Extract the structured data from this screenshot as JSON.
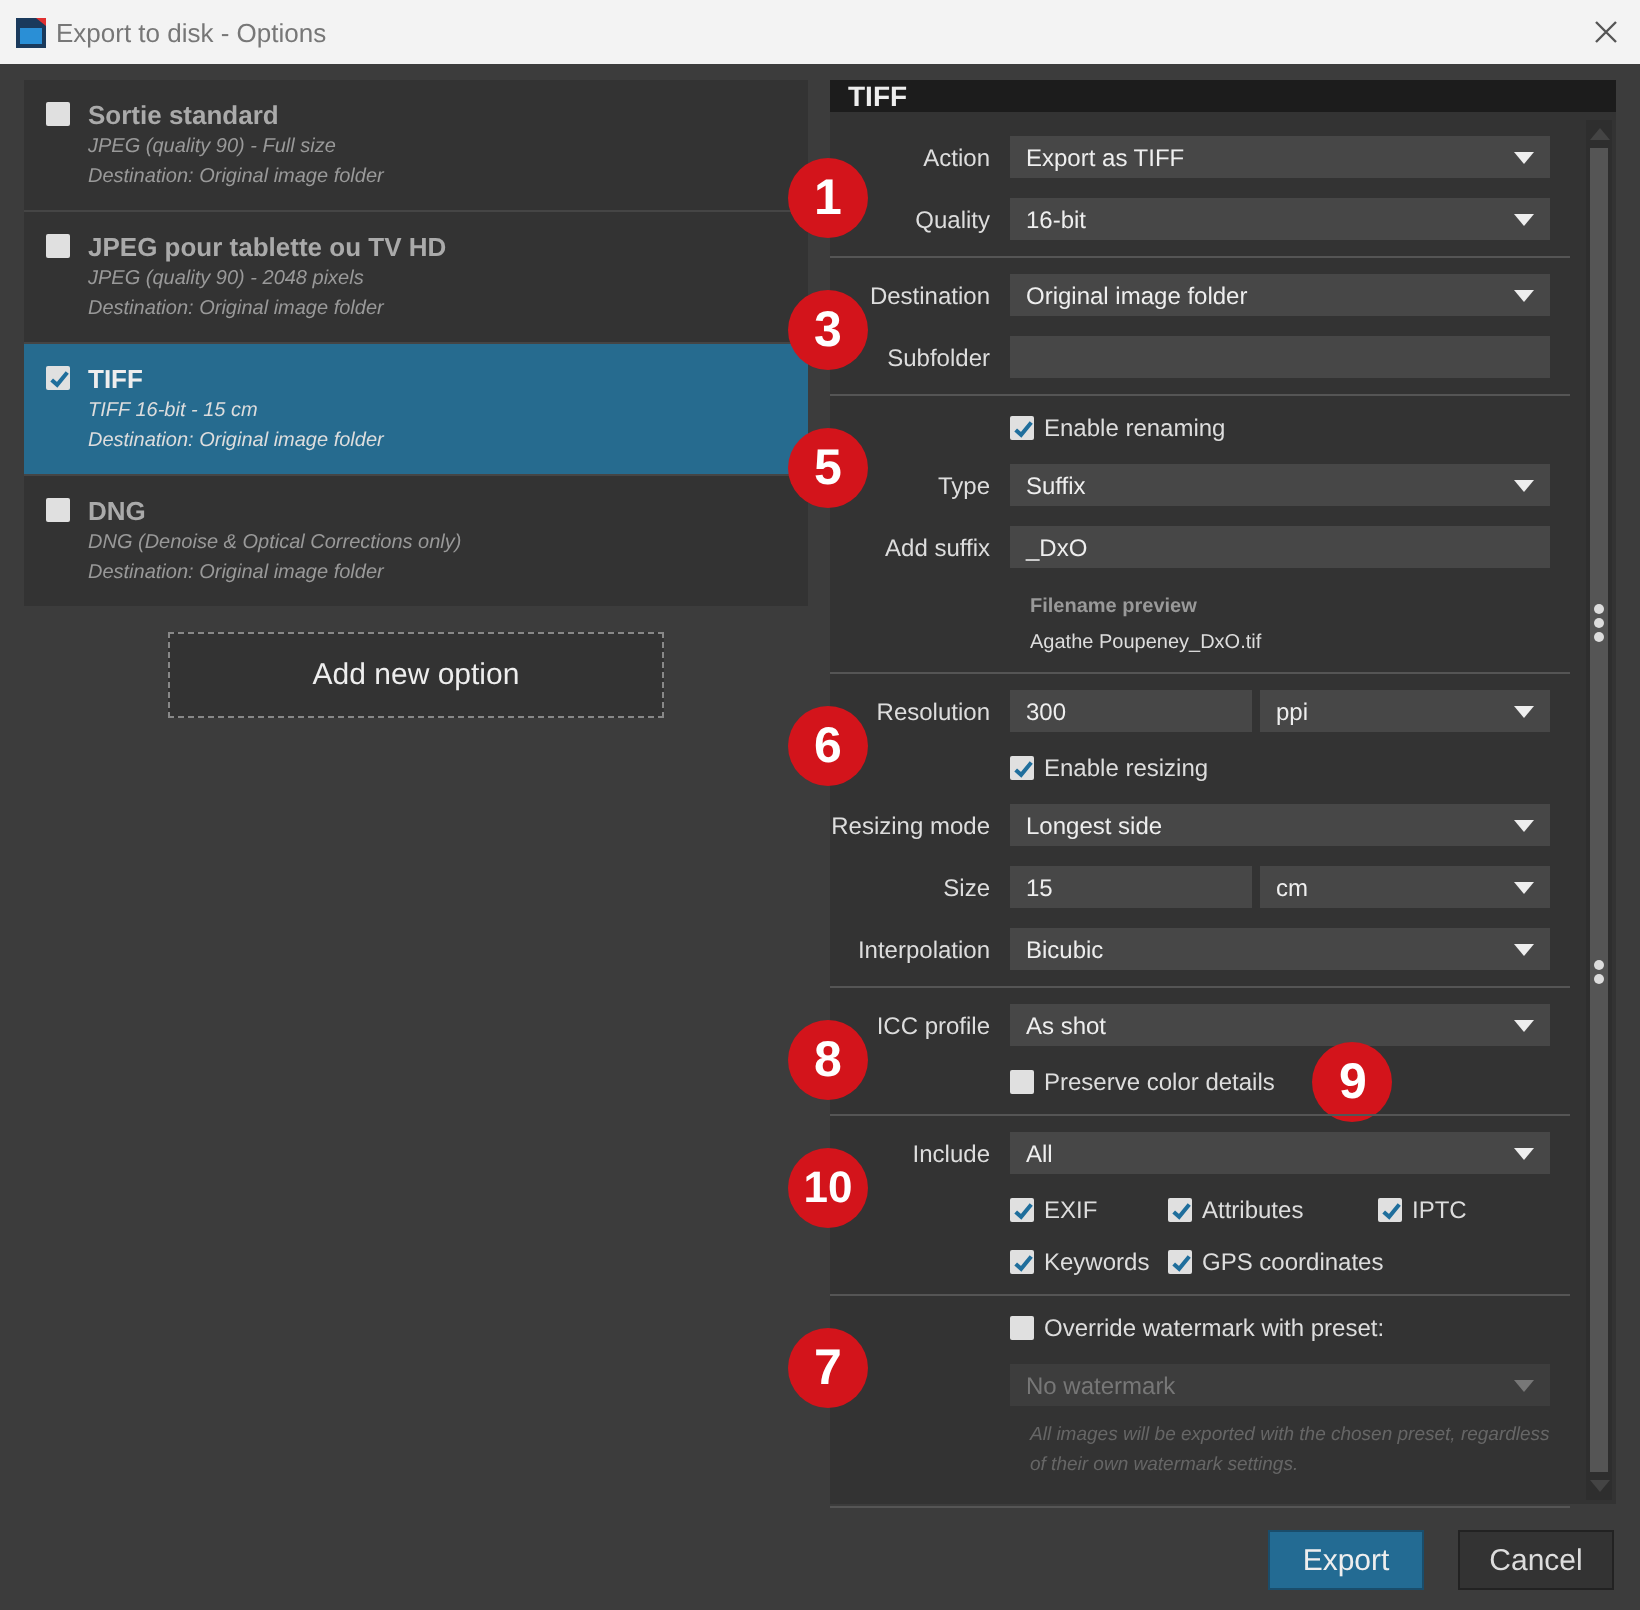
{
  "window": {
    "title": "Export to disk - Options"
  },
  "options": [
    {
      "name": "Sortie standard",
      "line1": "JPEG (quality 90) - Full size",
      "line2": "Destination: Original image folder",
      "checked": false,
      "selected": false
    },
    {
      "name": "JPEG pour tablette ou TV HD",
      "line1": "JPEG (quality 90) - 2048 pixels",
      "line2": "Destination: Original image folder",
      "checked": false,
      "selected": false
    },
    {
      "name": "TIFF",
      "line1": "TIFF 16-bit - 15 cm",
      "line2": "Destination: Original image folder",
      "checked": true,
      "selected": true
    },
    {
      "name": "DNG",
      "line1": "DNG (Denoise & Optical Corrections only)",
      "line2": "Destination: Original image folder",
      "checked": false,
      "selected": false
    }
  ],
  "add_button": "Add new option",
  "panel": {
    "title": "TIFF",
    "sections": [
      {
        "marker": "1",
        "rows": [
          {
            "kind": "select",
            "label": "Action",
            "value": "Export as TIFF",
            "disabled": false
          },
          {
            "kind": "select",
            "label": "Quality",
            "value": "16-bit",
            "disabled": false
          }
        ]
      },
      {
        "marker": "3",
        "rows": [
          {
            "kind": "select",
            "label": "Destination",
            "value": "Original image folder",
            "disabled": false
          },
          {
            "kind": "input",
            "label": "Subfolder"
          }
        ]
      },
      {
        "marker": "5",
        "rows": [
          {
            "kind": "checkbox",
            "label": "Enable renaming",
            "checked": true
          },
          {
            "kind": "select",
            "label": "Type",
            "value": "Suffix",
            "disabled": false
          },
          {
            "kind": "input",
            "label": "Add suffix",
            "value": "_DxO"
          },
          {
            "kind": "preview",
            "label": "Filename preview",
            "value": "Agathe Poupeney_DxO.tif"
          }
        ]
      },
      {
        "marker": "6",
        "rows": [
          {
            "kind": "split",
            "label": "Resolution",
            "value": "300",
            "unit": "ppi"
          },
          {
            "kind": "checkbox",
            "label": "Enable resizing",
            "checked": true
          },
          {
            "kind": "select",
            "label": "Resizing mode",
            "value": "Longest side",
            "disabled": false
          },
          {
            "kind": "split",
            "label": "Size",
            "value": "15",
            "unit": "cm"
          },
          {
            "kind": "select",
            "label": "Interpolation",
            "value": "Bicubic",
            "disabled": false
          }
        ]
      },
      {
        "marker": "8",
        "rows": [
          {
            "kind": "select",
            "label": "ICC profile",
            "value": "As shot",
            "disabled": false
          },
          {
            "kind": "checkbox",
            "label": "Preserve color details",
            "checked": false,
            "marker": "9"
          }
        ]
      },
      {
        "marker": "10",
        "rows": [
          {
            "kind": "select",
            "label": "Include",
            "value": "All",
            "disabled": false
          },
          {
            "kind": "checks",
            "items": [
              {
                "label": "EXIF",
                "checked": true
              },
              {
                "label": "Attributes",
                "checked": true
              },
              {
                "label": "IPTC",
                "checked": true
              },
              {
                "label": "Keywords",
                "checked": true
              },
              {
                "label": "GPS coordinates",
                "checked": true
              }
            ]
          }
        ]
      },
      {
        "marker": "7",
        "rows": [
          {
            "kind": "checkbox",
            "label": "Override watermark with preset:",
            "checked": false
          },
          {
            "kind": "select",
            "value": "No watermark",
            "disabled": true
          },
          {
            "kind": "note",
            "text": "All images will be exported with the chosen preset, regardless of their own watermark settings."
          }
        ]
      }
    ]
  },
  "buttons": [
    {
      "label": "Export",
      "primary": true
    },
    {
      "label": "Cancel",
      "primary": false
    }
  ]
}
